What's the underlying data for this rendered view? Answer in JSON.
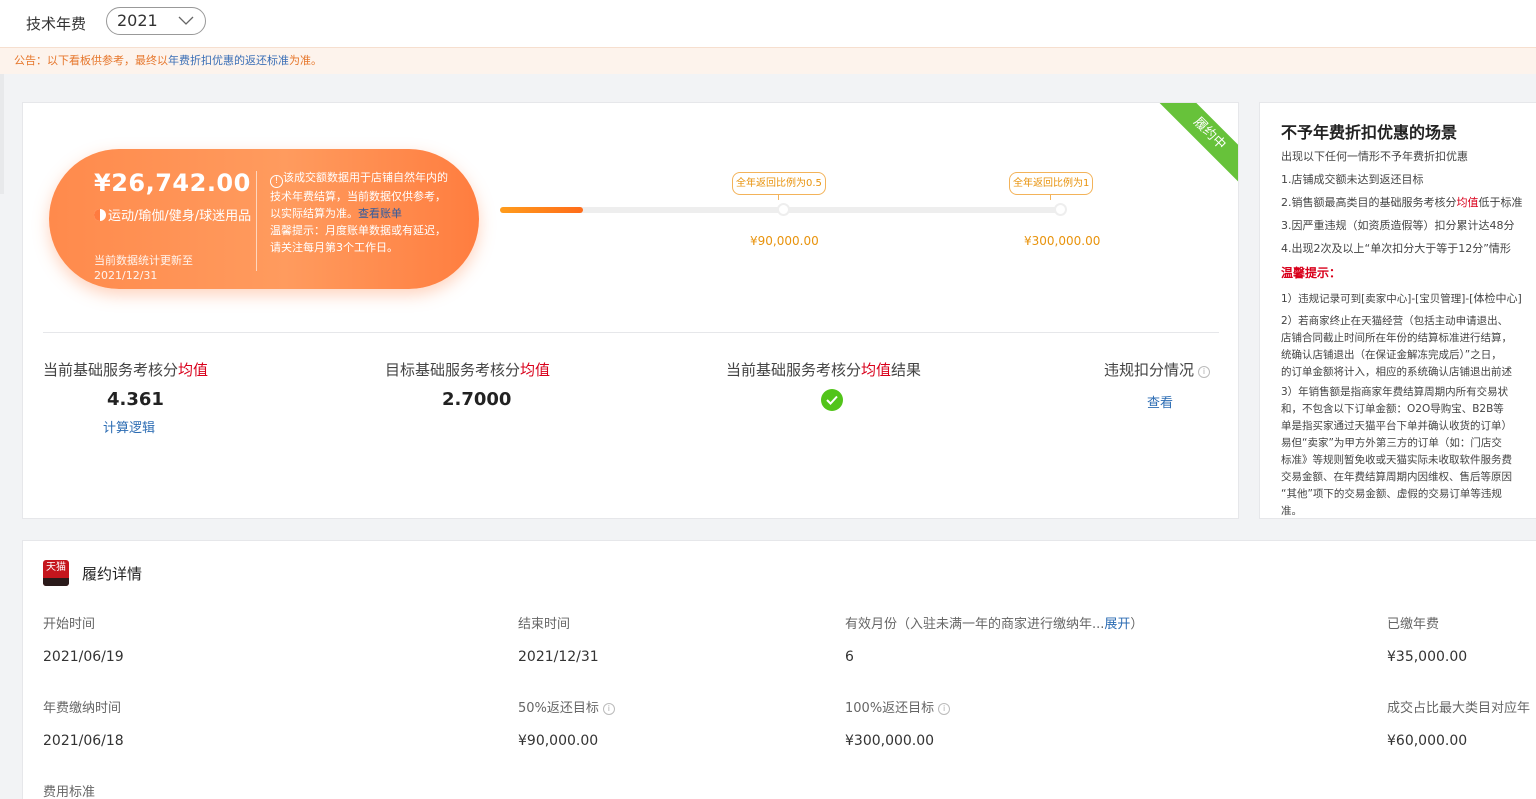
{
  "header": {
    "title": "技术年费",
    "year_select": "2021"
  },
  "notice": {
    "prefix": "公告：以下看板供参考，最终以",
    "link": "年费折扣优惠的返还标准",
    "suffix": "为准。"
  },
  "summary": {
    "ribbon": "履约中",
    "amount": "¥26,742.00",
    "category": "运动/瑜伽/健身/球迷用品",
    "update_label": "当前数据统计更新至",
    "update_date": "2021/12/31",
    "info_icon": "!",
    "info_text": "该成交额数据用于店铺自然年内的技术年费结算，当前数据仅供参考，以实际结算为准。",
    "info_link": "查看账单",
    "info_tip": "温馨提示：月度账单数据或有延迟，请关注每月第3个工作日。",
    "progress_fraction": 0.148,
    "milestones": [
      {
        "tag": "全年返回比例为0.5",
        "value": "¥90,000.00"
      },
      {
        "tag": "全年返回比例为1",
        "value": "¥300,000.00"
      }
    ]
  },
  "stats": [
    {
      "label_prefix": "当前基础服务考核分",
      "label_red": "均值",
      "label_suffix": "",
      "value": "4.361",
      "link": "计算逻辑"
    },
    {
      "label_prefix": "目标基础服务考核分",
      "label_red": "均值",
      "label_suffix": "",
      "value": "2.7000"
    },
    {
      "label_prefix": "当前基础服务考核分",
      "label_red": "均值",
      "label_suffix": "结果",
      "status_icon": "check-circle-icon"
    },
    {
      "label_prefix": "违规扣分情况",
      "help_icon": "i",
      "link": "查看"
    }
  ],
  "rules": {
    "title": "不予年费折扣优惠的场景",
    "subtitle": "出现以下任何一情形不予年费折扣优惠",
    "items": [
      "1.店铺成交额未达到返还目标",
      "2.销售额最高类目的基础服务考核分",
      "3.因严重违规（如资质造假等）扣分累计达48分",
      "4.出现2次及以上“单次扣分大于等于12分”情形"
    ],
    "item2_red": "均值",
    "item2_tail": "低于标准",
    "warn_title": "温馨提示：",
    "tip1_prefix": "1）违规记录可到[卖家中心]-[宝贝管理]-",
    "tip1_link": "[体检中心]",
    "tip2": [
      "2）若商家终止在天猫经营（包括主动申请退出、",
      "店铺合同截止时间所在年份的结算标准进行结算，",
      "统确认店铺退出（在保证金解冻完成后）”之日，",
      "的订单金额将计入，相应的系统确认店铺退出前述"
    ],
    "tip3": [
      "3）年销售额是指商家年费结算周期内所有交易状",
      "和，不包含以下订单金额：O2O导购宝、B2B等",
      "单是指买家通过天猫平台下单并确认收货的订单）",
      "易但“卖家”为甲方外第三方的订单（如：门店交",
      "标准》等规则暂免收或天猫实际未收取软件服务费",
      "交易金额、在年费结算周期内因维权、售后等原因",
      "“其他”项下的交易金额、虚假的交易订单等违规",
      "准。"
    ]
  },
  "detail": {
    "logo_text": "天猫",
    "title": "履约详情",
    "fields": [
      {
        "label": "开始时间",
        "value": "2021/06/19"
      },
      {
        "label": "结束时间",
        "value": "2021/12/31"
      },
      {
        "label": "有效月份（入驻未满一年的商家进行缴纳年...",
        "label_link": "展开",
        "label_tail": "）",
        "value": "6"
      },
      {
        "label": "已缴年费",
        "value": "¥35,000.00"
      },
      {
        "label": "年费缴纳时间",
        "value": "2021/06/18"
      },
      {
        "label": "50%返还目标",
        "help": "i",
        "value": "¥90,000.00"
      },
      {
        "label": "100%返还目标",
        "help": "i",
        "value": "¥300,000.00"
      },
      {
        "label": "成交占比最大类目对应年",
        "value": "¥60,000.00"
      },
      {
        "label": "费用标准"
      }
    ]
  }
}
